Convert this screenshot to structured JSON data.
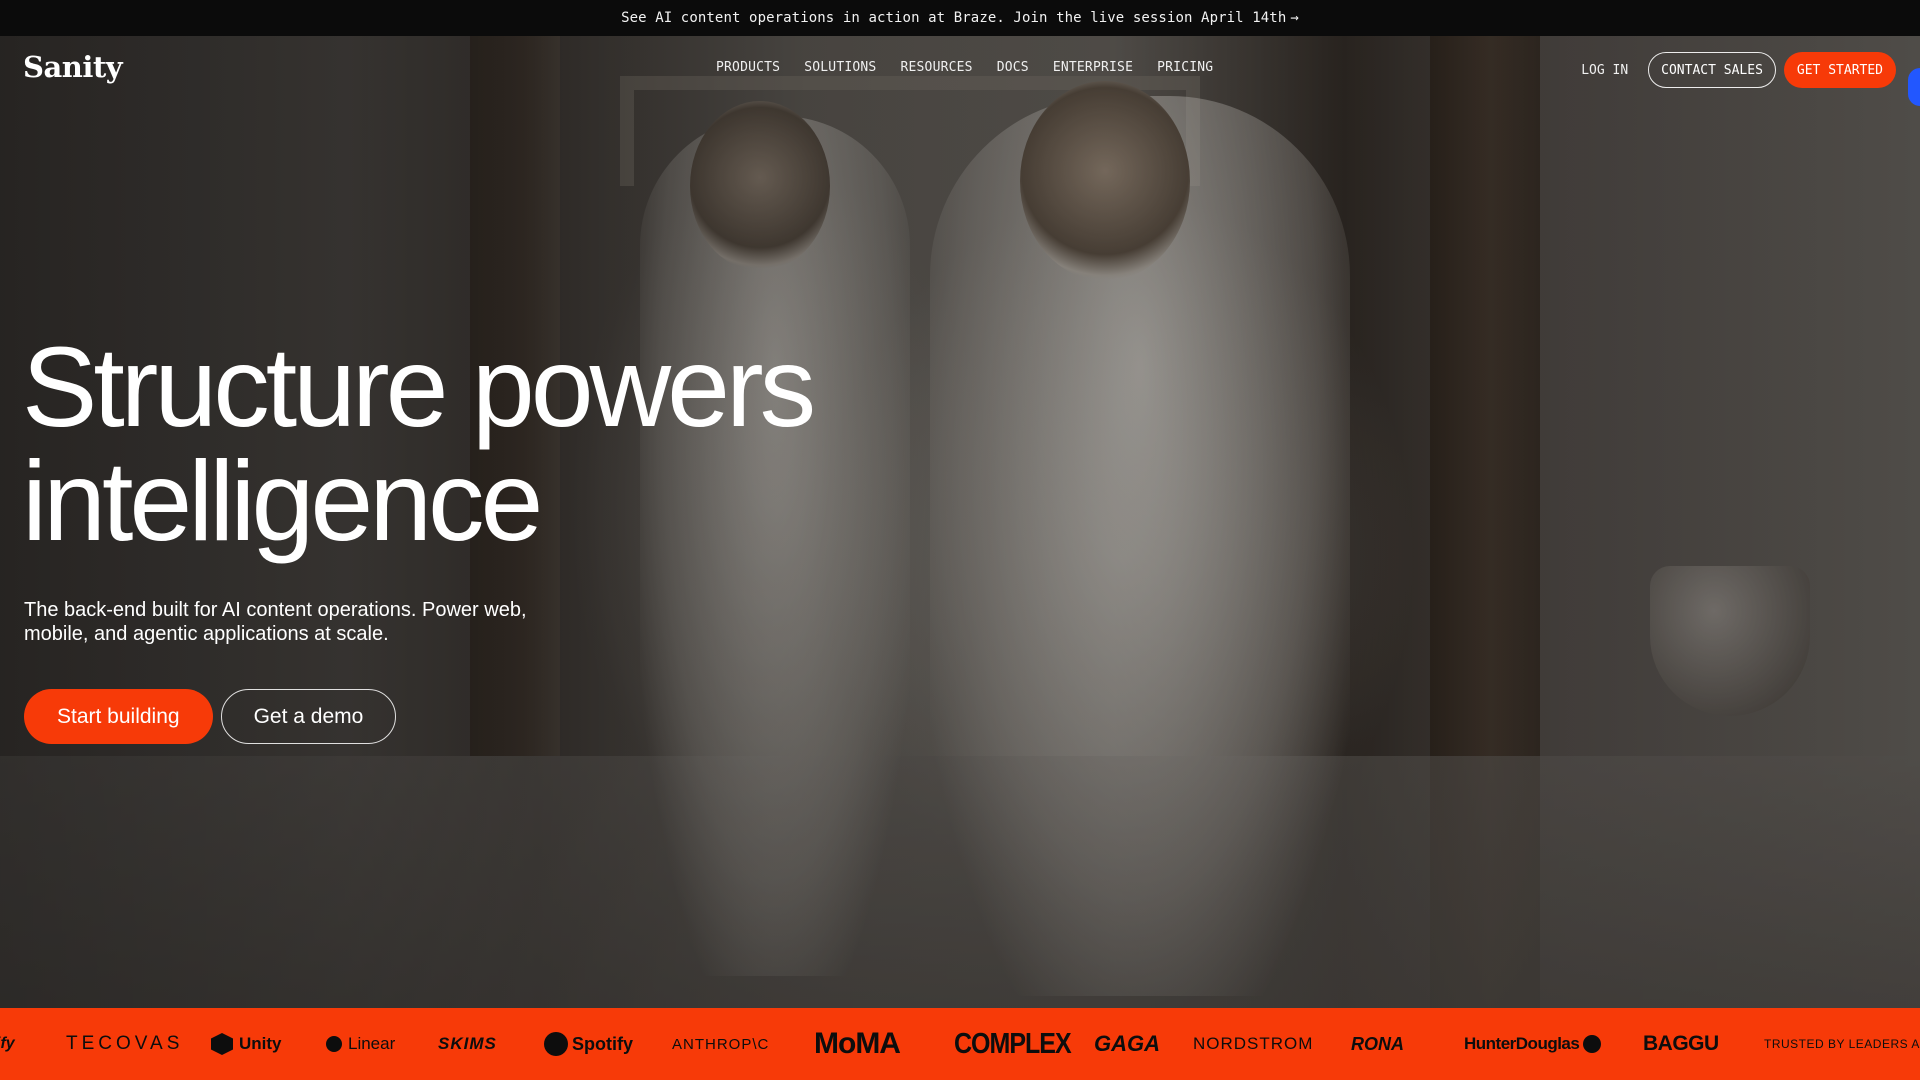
{
  "announcement": {
    "text": "See AI content operations in action at Braze. Join the live session April 14th",
    "arrow": "→"
  },
  "header": {
    "logo": "Sanity",
    "nav": [
      "PRODUCTS",
      "SOLUTIONS",
      "RESOURCES",
      "DOCS",
      "ENTERPRISE",
      "PRICING"
    ],
    "login": "LOG IN",
    "contact_sales": "CONTACT SALES",
    "get_started": "GET STARTED"
  },
  "hero": {
    "headline_line1": "Structure powers",
    "headline_line2": "intelligence",
    "subtext": "The back-end built for AI content operations. Power web, mobile, and agentic applications at scale.",
    "primary_cta": "Start building",
    "secondary_cta": "Get a demo"
  },
  "logos": {
    "items": [
      "ify",
      "TECOVAS",
      "Unity",
      "Linear",
      "SKIMS",
      "Spotify",
      "ANTHROP\\C",
      "MoMA",
      "COMPLEX",
      "GAGA",
      "NORDSTROM",
      "RONA",
      "HunterDouglas",
      "BAGGU"
    ],
    "trusted_text": "TRUSTED BY LEADERS AND"
  },
  "colors": {
    "accent": "#f73a08",
    "announcement_bg": "#0b0b0b",
    "floating_dot": "#2257ff"
  },
  "icons": {
    "unity": "unity-cube-icon",
    "linear": "linear-logo-icon",
    "spotify": "spotify-logo-icon",
    "hunterdouglas": "hunterdouglas-mark-icon"
  }
}
